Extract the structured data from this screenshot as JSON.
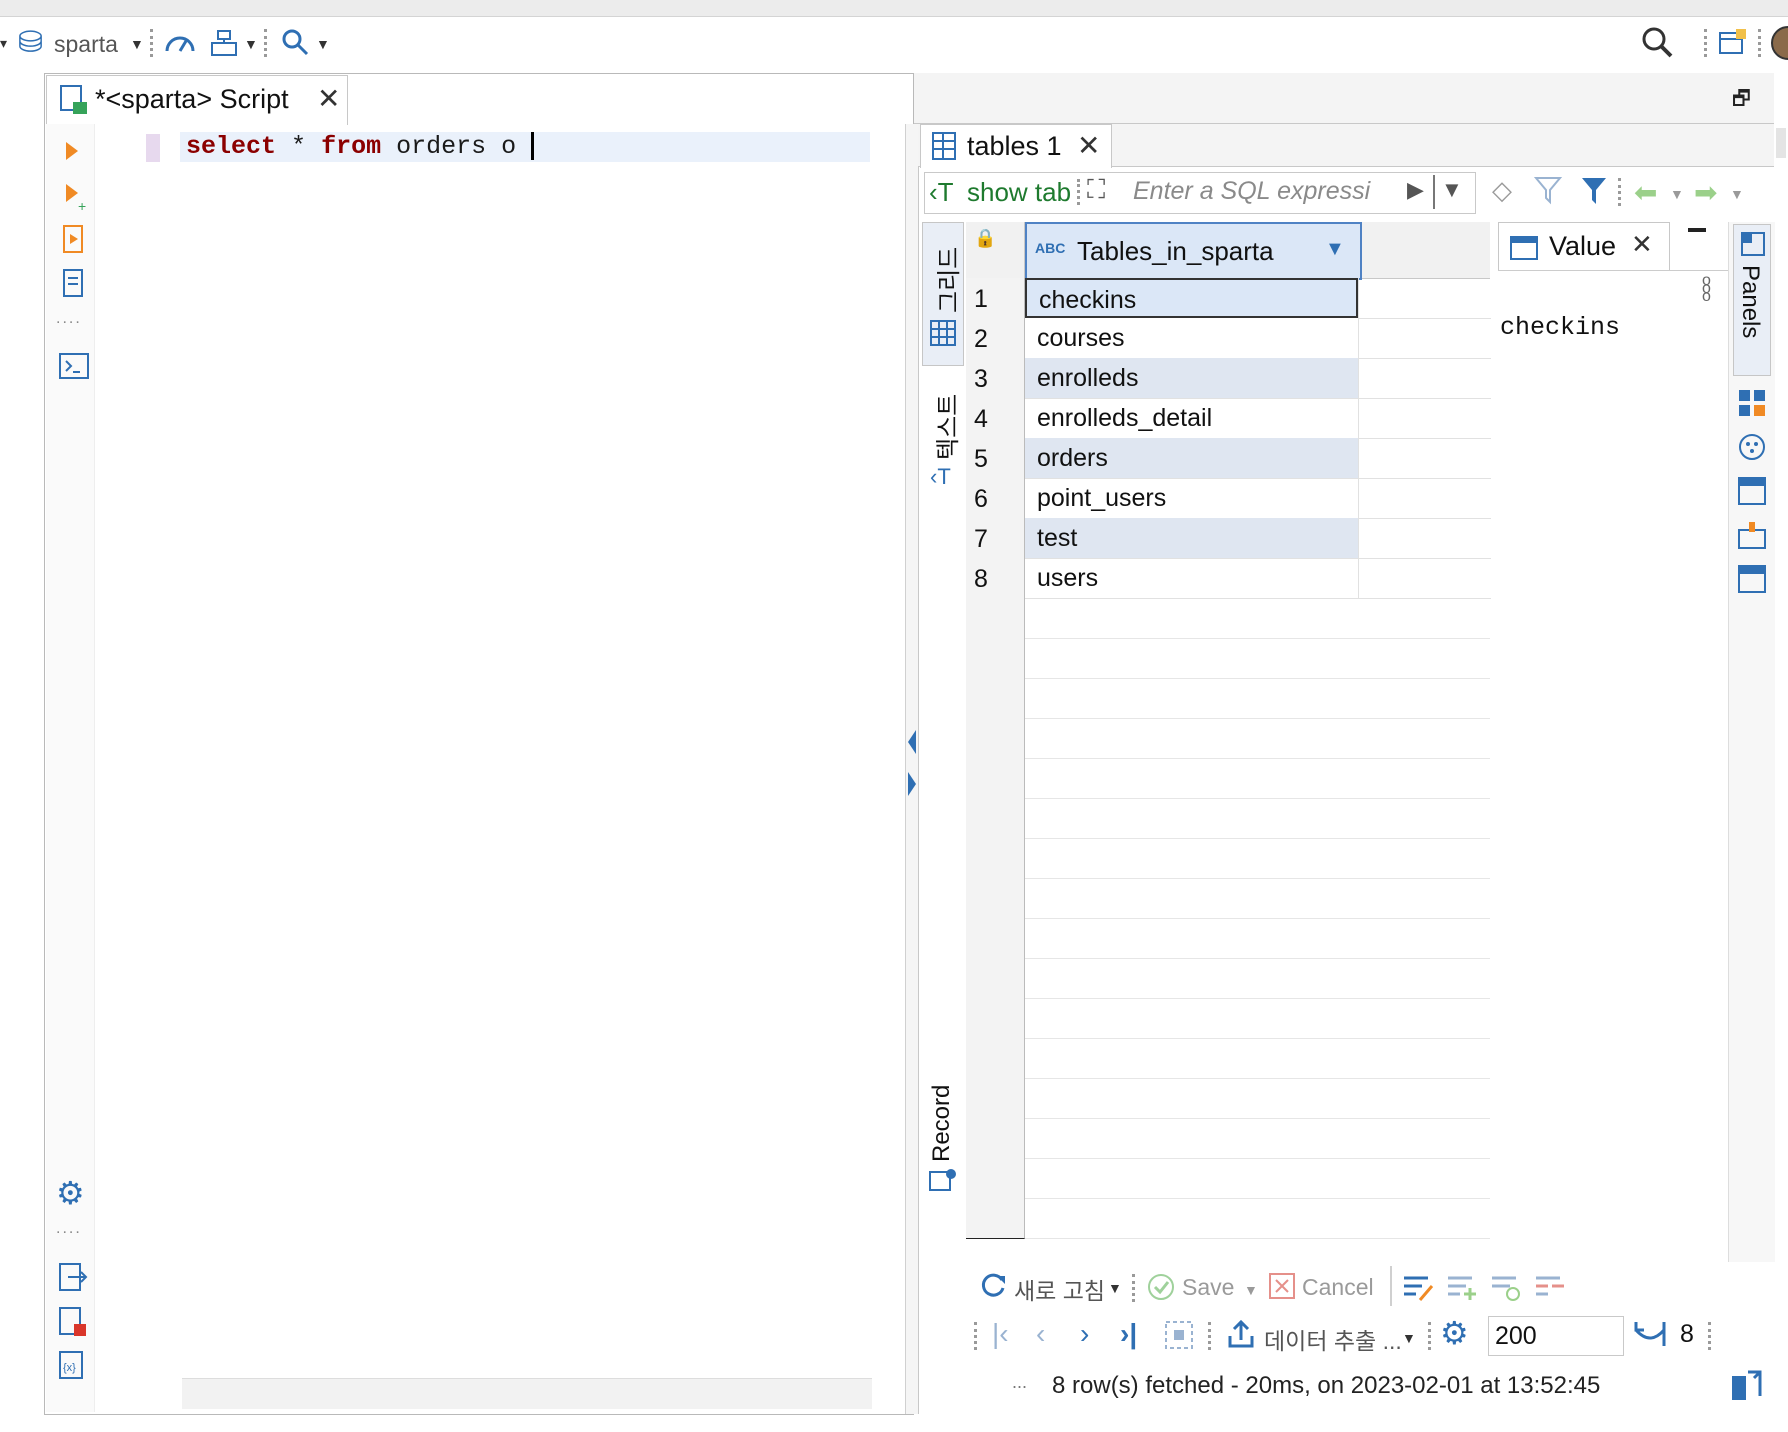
{
  "toolbar": {
    "connection_label": "sparta",
    "colors": {
      "accent": "#2f6fb3",
      "keyword": "#8b0000"
    }
  },
  "editor": {
    "tab_title": "*<sparta> Script",
    "code": {
      "keyword_select": "select",
      "star": "*",
      "keyword_from": "from",
      "rest": "orders o"
    }
  },
  "results": {
    "tab_title": "tables 1",
    "filter": {
      "quick_label": "show tab",
      "placeholder": "Enter a SQL expressi"
    },
    "vertical_tabs": {
      "grid": "그리드",
      "text": "텍스트",
      "record": "Record"
    },
    "grid": {
      "column_header": "Tables_in_sparta",
      "column_type_badge": "ABC",
      "rows": [
        {
          "num": "1",
          "value": "checkins"
        },
        {
          "num": "2",
          "value": "courses"
        },
        {
          "num": "3",
          "value": "enrolleds"
        },
        {
          "num": "4",
          "value": "enrolleds_detail"
        },
        {
          "num": "5",
          "value": "orders"
        },
        {
          "num": "6",
          "value": "point_users"
        },
        {
          "num": "7",
          "value": "test"
        },
        {
          "num": "8",
          "value": "users"
        }
      ]
    },
    "value_panel": {
      "tab_title": "Value",
      "content": "checkins",
      "side_label": "Panels"
    },
    "actions": {
      "refresh": "새로 고침",
      "save": "Save",
      "cancel": "Cancel",
      "export": "데이터 추출 ...",
      "fetch_size": "200",
      "row_count": "8"
    },
    "status": "8 row(s) fetched - 20ms, on 2023-02-01 at 13:52:45",
    "status_prefix": "..."
  }
}
